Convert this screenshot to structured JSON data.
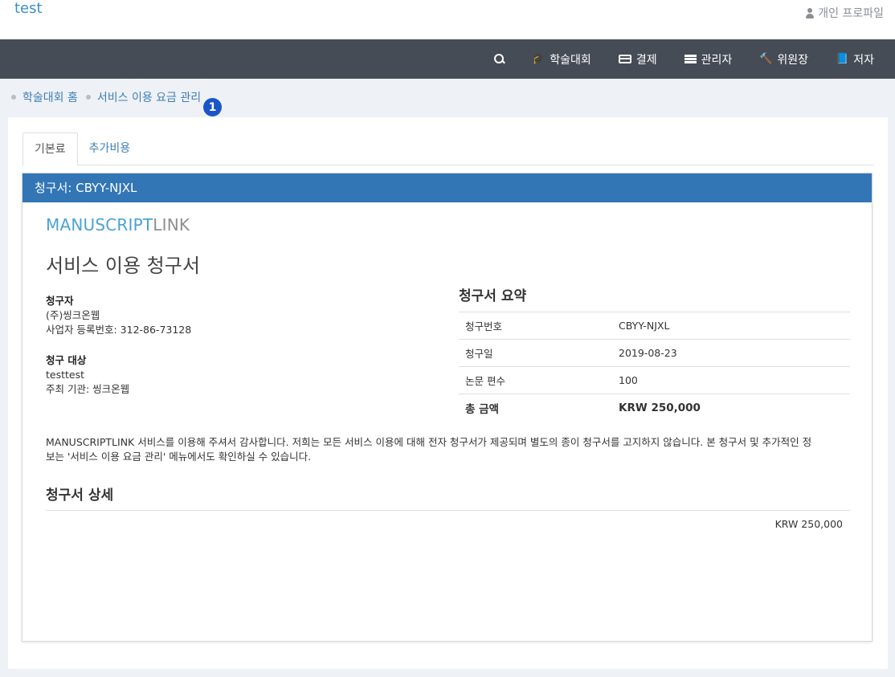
{
  "header": {
    "brand": "test",
    "profile_label": "개인 프로파일"
  },
  "nav": {
    "items": [
      {
        "label": "학술대회",
        "icon": "graduation-cap-icon"
      },
      {
        "label": "결제",
        "icon": "credit-card-icon"
      },
      {
        "label": "관리자",
        "icon": "server-icon"
      },
      {
        "label": "위원장",
        "icon": "gavel-icon"
      },
      {
        "label": "저자",
        "icon": "book-icon"
      }
    ]
  },
  "breadcrumb": {
    "items": [
      "학술대회 홈",
      "서비스 이용 요금 관리"
    ],
    "marker": "1"
  },
  "tabs": [
    {
      "label": "기본료",
      "active": true
    },
    {
      "label": "추가비용",
      "active": false
    }
  ],
  "invoice": {
    "header": "청구서: CBYY-NJXL",
    "logo_part1": "MANUSCRIPT",
    "logo_part2": "LINK",
    "title": "서비스 이용 청구서",
    "biller_label": "청구자",
    "biller_name": "(주)씽크온웹",
    "biller_reg": "사업자 등록번호: 312-86-73128",
    "target_label": "청구 대상",
    "target_name": "testtest",
    "target_org": "주최 기관: 씽크온웹",
    "summary": {
      "title": "청구서 요약",
      "rows": [
        {
          "key": "청구번호",
          "value": "CBYY-NJXL"
        },
        {
          "key": "청구일",
          "value": "2019-08-23"
        },
        {
          "key": "논문 편수",
          "value": "100"
        },
        {
          "key": "총 금액",
          "value": "KRW 250,000"
        }
      ]
    },
    "notice_line1": "MANUSCRIPTLINK 서비스를 이용해 주셔서 감사합니다. 저희는 모든 서비스 이용에 대해 전자 청구서가 제공되며 별도의 종이 청구서를 고지하지 않습니다. 본 청구서 및 추가적인 정",
    "notice_line2": "보는 '서비스 이용 요금 관리' 메뉴에서도 확인하실 수 있습니다.",
    "detail_title": "청구서 상세",
    "detail_amount": "KRW 250,000"
  },
  "colors": {
    "navbar": "#464c56",
    "panel_header": "#3276b5",
    "link": "#3f7fb5",
    "badge": "#1a56c9"
  }
}
